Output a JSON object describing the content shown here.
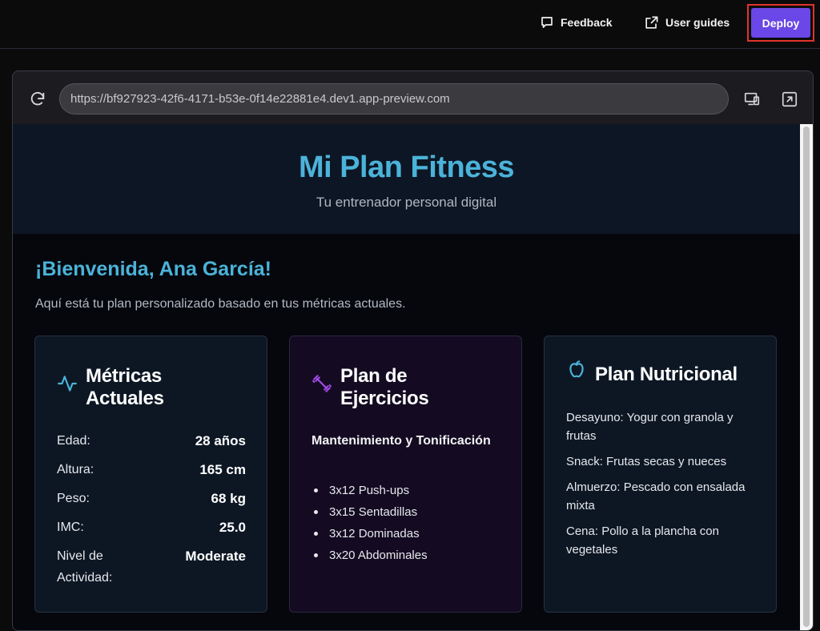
{
  "topbar": {
    "feedback_label": "Feedback",
    "guides_label": "User guides",
    "deploy_label": "Deploy"
  },
  "browser": {
    "url": "https://bf927923-42f6-4171-b53e-0f14e22881e4.dev1.app-preview.com"
  },
  "app": {
    "title": "Mi Plan Fitness",
    "subtitle": "Tu entrenador personal digital",
    "welcome": "¡Bienvenida, Ana García!",
    "intro": "Aquí está tu plan personalizado basado en tus métricas actuales.",
    "metrics_card": {
      "title": "Métricas Actuales",
      "icon": "activity-icon",
      "rows": [
        {
          "label": "Edad:",
          "value": "28 años"
        },
        {
          "label": "Altura:",
          "value": "165 cm"
        },
        {
          "label": "Peso:",
          "value": "68 kg"
        },
        {
          "label": "IMC:",
          "value": "25.0"
        },
        {
          "label": "Nivel de Actividad:",
          "value": "Moderate"
        }
      ]
    },
    "exercise_card": {
      "title": "Plan de Ejercicios",
      "icon": "dumbbell-icon",
      "plan_name": "Mantenimiento y Tonificación",
      "items": [
        "3x12 Push-ups",
        "3x15 Sentadillas",
        "3x12 Dominadas",
        "3x20 Abdominales"
      ]
    },
    "nutrition_card": {
      "title": "Plan Nutricional",
      "icon": "apple-icon",
      "meals": [
        "Desayuno: Yogur con granola y frutas",
        "Snack: Frutas secas y nueces",
        "Almuerzo: Pescado con ensalada mixta",
        "Cena: Pollo a la plancha con vegetales"
      ]
    }
  },
  "colors": {
    "accent": "#4bb3d9",
    "deploy": "#6a47e6",
    "exercise_icon": "#a24be8"
  }
}
